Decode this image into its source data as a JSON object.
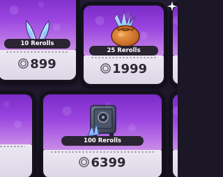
{
  "shop": {
    "items": [
      {
        "label": "10 Rerolls",
        "price": "899",
        "icon": "crystal-wings-icon"
      },
      {
        "label": "25 Rerolls",
        "price": "1999",
        "icon": "crystal-sack-icon"
      },
      {
        "label": "100 Rerolls",
        "price": "6399",
        "icon": "crystal-safe-icon"
      }
    ]
  },
  "colors": {
    "card_top_start": "#7a2bc7",
    "card_top_end": "#c98be8",
    "card_bottom": "#e9e5ef",
    "pill": "#2a2433",
    "price_text": "#2b2733"
  }
}
